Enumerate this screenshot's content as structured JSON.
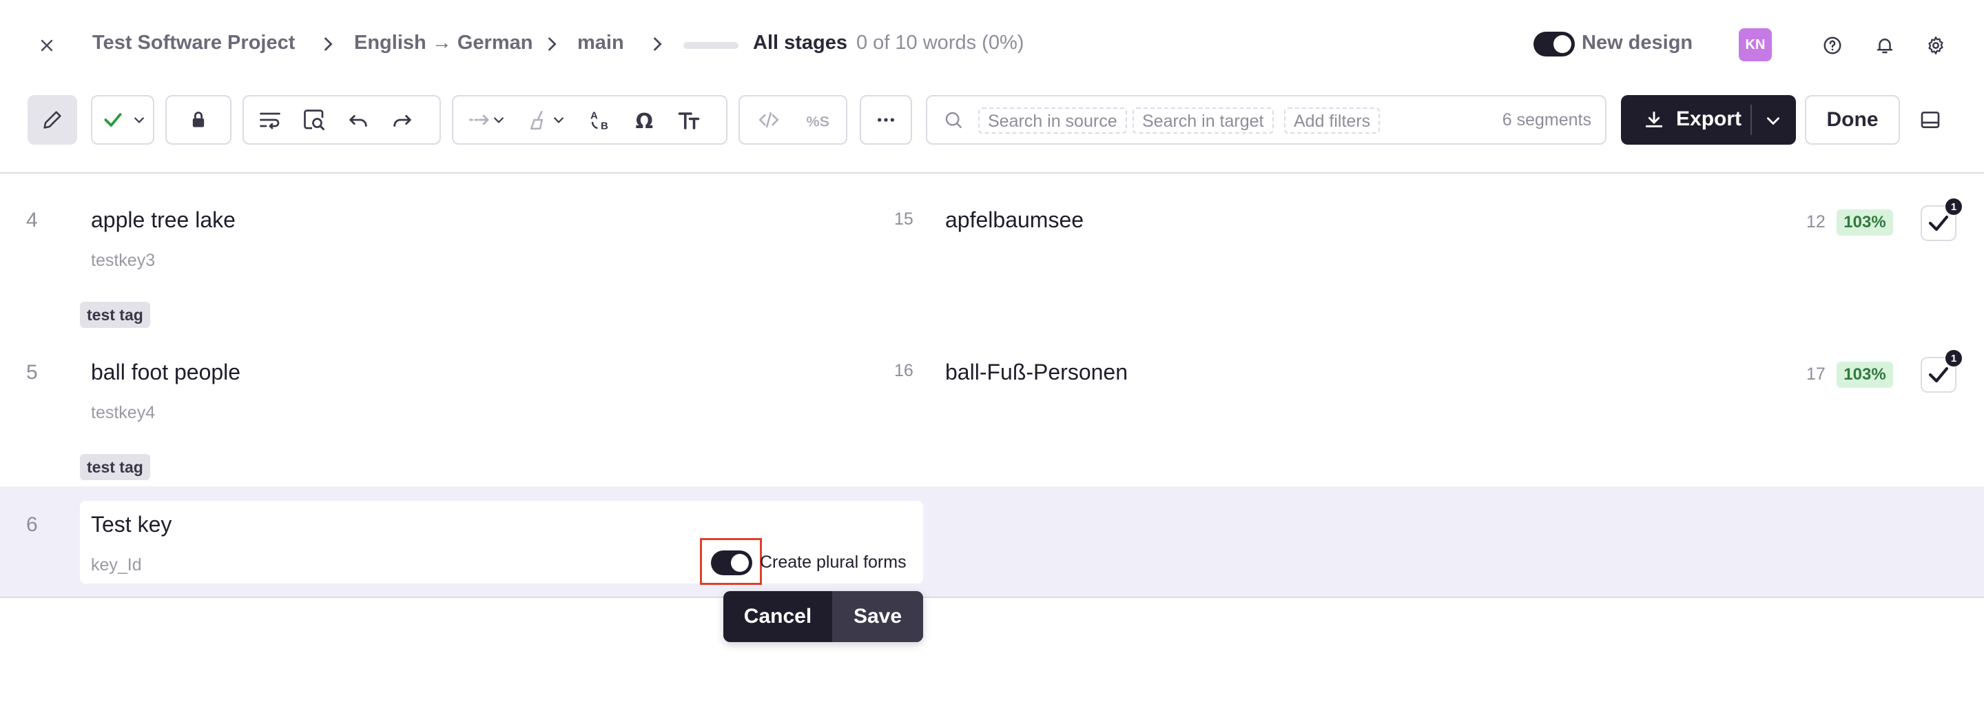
{
  "header": {
    "breadcrumbs": [
      "Test Software Project",
      "English → German",
      "main"
    ],
    "stage_label": "All stages",
    "stage_words": "0 of 10 words  (0%)",
    "new_design_label": "New design",
    "avatar_initials": "KN"
  },
  "search": {
    "chips": [
      "Search in source",
      "Search in target",
      "Add filters"
    ],
    "segments_label": "6 segments"
  },
  "actions": {
    "export_label": "Export",
    "done_label": "Done"
  },
  "rows": [
    {
      "num": "4",
      "source": "apple tree lake",
      "key": "testkey3",
      "source_count": "15",
      "target": "apfelbaumsee",
      "target_count": "12",
      "match": "103%",
      "badge": "1",
      "tag": "test tag"
    },
    {
      "num": "5",
      "source": "ball foot people",
      "key": "testkey4",
      "source_count": "16",
      "target": "ball-Fuß-Personen",
      "target_count": "17",
      "match": "103%",
      "badge": "1",
      "tag": "test tag"
    }
  ],
  "active_row": {
    "num": "6",
    "source": "Test key",
    "key": "key_Id",
    "plural_label": "Create plural forms",
    "cancel_label": "Cancel",
    "save_label": "Save"
  }
}
